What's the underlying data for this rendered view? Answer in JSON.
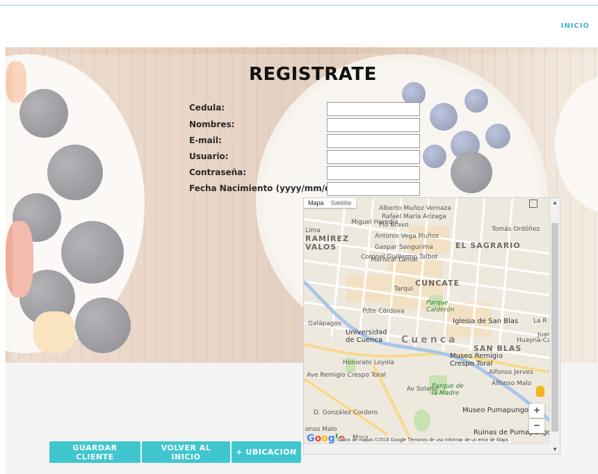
{
  "nav": {
    "inicio_label": "INICIO"
  },
  "form": {
    "title": "REGISTRATE",
    "fields": [
      {
        "label": "Cedula:",
        "value": ""
      },
      {
        "label": "Nombres:",
        "value": ""
      },
      {
        "label": "E-mail:",
        "value": ""
      },
      {
        "label": "Usuario:",
        "value": ""
      },
      {
        "label": "Contraseña:",
        "value": ""
      },
      {
        "label": "Fecha Nacimiento (yyyy/mm/dd):",
        "value": ""
      }
    ]
  },
  "map": {
    "type_map": "Mapa",
    "type_satellite": "Satélite",
    "labels": {
      "alberto": "Alberto Muñoz Vernaza",
      "rafael": "Rafael María Arizaga",
      "pio": "Pío Bravo",
      "antonio": "Antonio Vega Muñoz",
      "gaspar": "Gaspar Sangurima",
      "mariscal": "Mariscal Lamar",
      "sagrario": "EL SAGRARIO",
      "ramirez": "RAMÍREZ",
      "avalos": "VALOS",
      "cuncate": "CUNCATE",
      "parque_calderon": "Parque Calderón",
      "pdte": "Pdte Córdova",
      "iglesia": "Iglesia de San Blas",
      "universidad": "Universidad de Cuenca",
      "cuenca": "Cuenca",
      "sanblas": "SAN BLAS",
      "museo_remigio": "Museo Remigio Crespo Toral",
      "galapagos": "Galápagos",
      "honorato": "Honorato Loyola",
      "parque_madre": "Parque de la Madre",
      "museo_pumapungo": "Museo Pumapungo",
      "ruinas": "Ruinas de Pumapungo",
      "remigio_crespo": "Ave Remigio Crespo Toral",
      "gonzalez": "D. González Cordero",
      "tomas": "Tomás Ordóñez",
      "huayna": "Huayna-Capac",
      "jerves": "Alfonso Jerves",
      "malo": "Alfonso Malo",
      "larep": "La R",
      "juan": "Juan",
      "coronel": "Coronel Guillermo Talbot",
      "tarqui": "Tarqui",
      "miguel": "Miguel Heredia",
      "solano": "Av Solano",
      "lima": "Lima",
      "mora": "Mora",
      "alonso": "onso Malo"
    },
    "google": "Google",
    "footer": "Datos de mapas ©2018 Google   Términos de uso   Informar de un error de Maps",
    "zoom_in": "+",
    "zoom_out": "−"
  },
  "buttons": {
    "save": "GUARDAR CLIENTE",
    "back": "VOLVER AL INICIO",
    "location": "+ UBICACION"
  },
  "colors": {
    "accent": "#3fc6cf",
    "nav": "#3cb8c4"
  }
}
